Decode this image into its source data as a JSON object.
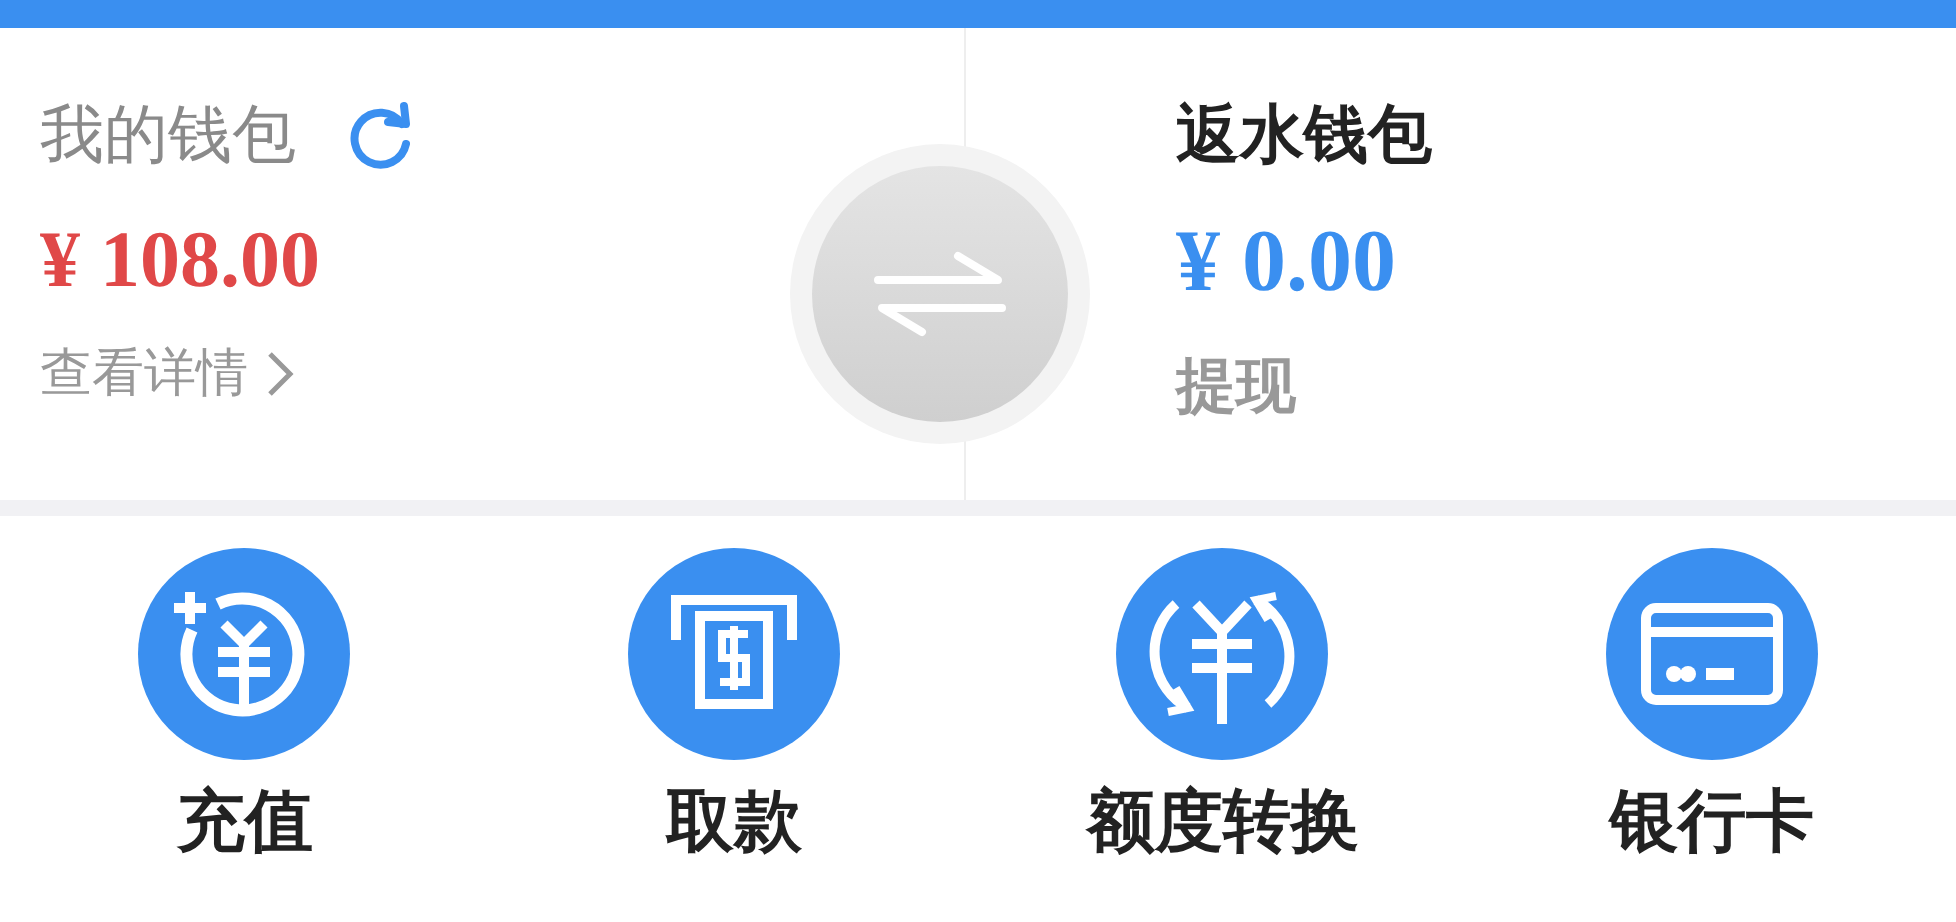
{
  "wallet": {
    "title": "我的钱包",
    "amount": "¥ 108.00",
    "details_link": "查看详情"
  },
  "rebate_wallet": {
    "title": "返水钱包",
    "amount": "¥ 0.00",
    "action": "提现"
  },
  "actions": [
    {
      "kind": "deposit",
      "label": "充值"
    },
    {
      "kind": "withdraw",
      "label": "取款"
    },
    {
      "kind": "convert",
      "label": "额度转换"
    },
    {
      "kind": "card",
      "label": "银行卡"
    }
  ]
}
